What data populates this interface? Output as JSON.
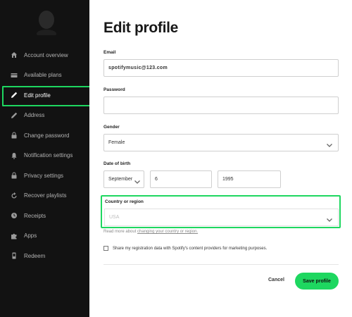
{
  "sidebar": {
    "items": [
      {
        "label": "Account overview",
        "icon": "home-icon"
      },
      {
        "label": "Available plans",
        "icon": "card-icon"
      },
      {
        "label": "Edit profile",
        "icon": "pen-icon",
        "active": true
      },
      {
        "label": "Address",
        "icon": "pen-icon"
      },
      {
        "label": "Change password",
        "icon": "lock-icon"
      },
      {
        "label": "Notification settings",
        "icon": "bell-icon"
      },
      {
        "label": "Privacy settings",
        "icon": "lock-icon"
      },
      {
        "label": "Recover playlists",
        "icon": "refresh-icon"
      },
      {
        "label": "Receipts",
        "icon": "clock-icon"
      },
      {
        "label": "Apps",
        "icon": "puzzle-icon"
      },
      {
        "label": "Redeem",
        "icon": "device-icon"
      }
    ]
  },
  "main": {
    "title": "Edit profile",
    "email": {
      "label": "Email",
      "value": "spotifymusic@123.com"
    },
    "password": {
      "label": "Password",
      "value": ""
    },
    "gender": {
      "label": "Gender",
      "value": "Female"
    },
    "dob": {
      "label": "Date of birth",
      "month": "September",
      "day": "6",
      "year": "1995"
    },
    "country": {
      "label": "Country or region",
      "value": "USA"
    },
    "helper": {
      "prefix": "Read more about",
      "link": "changing your country or region."
    },
    "share": {
      "label": "Share my registration data with Spotify's content providers for marketing purposes."
    },
    "actions": {
      "cancel": "Cancel",
      "save": "Save profile"
    }
  },
  "colors": {
    "accent": "#1ed760",
    "sidebar_bg": "#121212"
  }
}
